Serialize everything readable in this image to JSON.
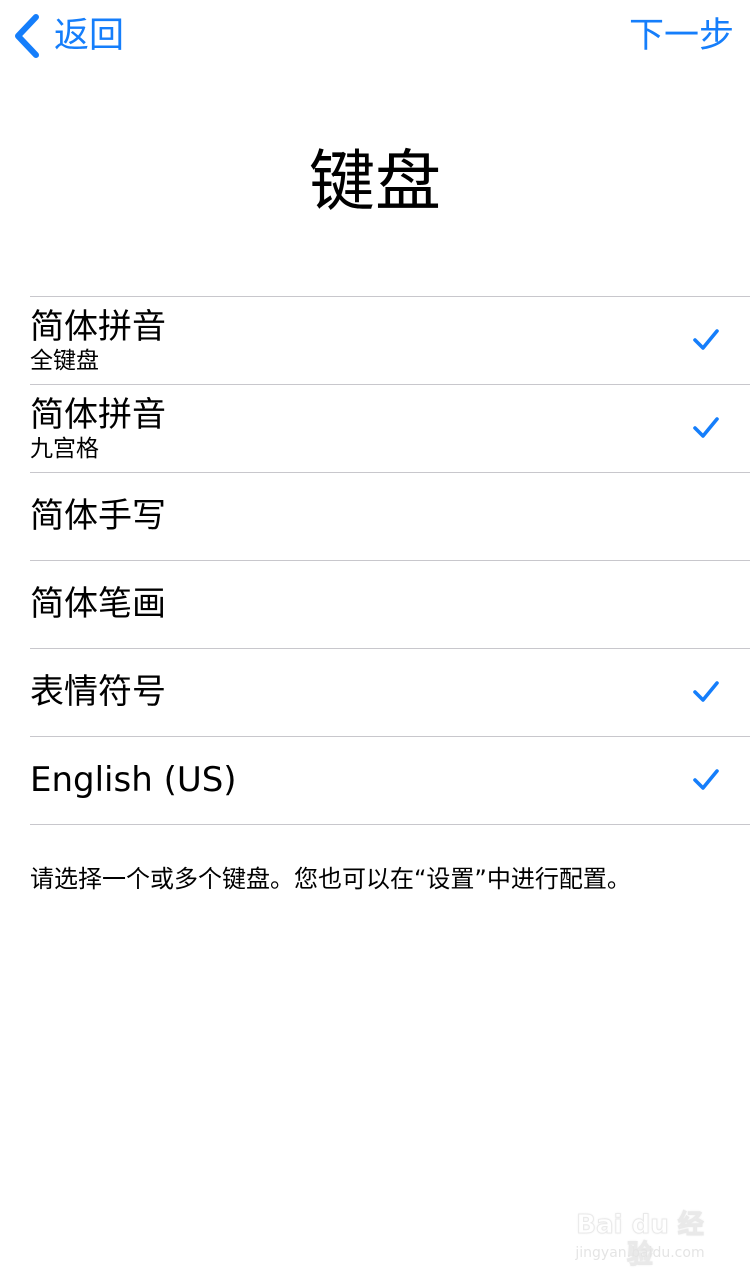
{
  "nav": {
    "back_label": "返回",
    "next_label": "下一步"
  },
  "title": "键盘",
  "keyboards": [
    {
      "title": "简体拼音",
      "subtitle": "全键盘",
      "selected": true
    },
    {
      "title": "简体拼音",
      "subtitle": "九宫格",
      "selected": true
    },
    {
      "title": "简体手写",
      "subtitle": "",
      "selected": false
    },
    {
      "title": "简体笔画",
      "subtitle": "",
      "selected": false
    },
    {
      "title": "表情符号",
      "subtitle": "",
      "selected": true
    },
    {
      "title": "English (US)",
      "subtitle": "",
      "selected": true
    }
  ],
  "footer_note": "请选择一个或多个键盘。您也可以在“设置”中进行配置。",
  "watermark": {
    "main": "Bai du 经验",
    "sub": "jingyan.baidu.com"
  },
  "colors": {
    "accent": "#157efb",
    "separator": "#c8c7cc",
    "text": "#000000",
    "background": "#ffffff"
  },
  "icons": {
    "back": "chevron-left-icon",
    "check": "checkmark-icon"
  }
}
